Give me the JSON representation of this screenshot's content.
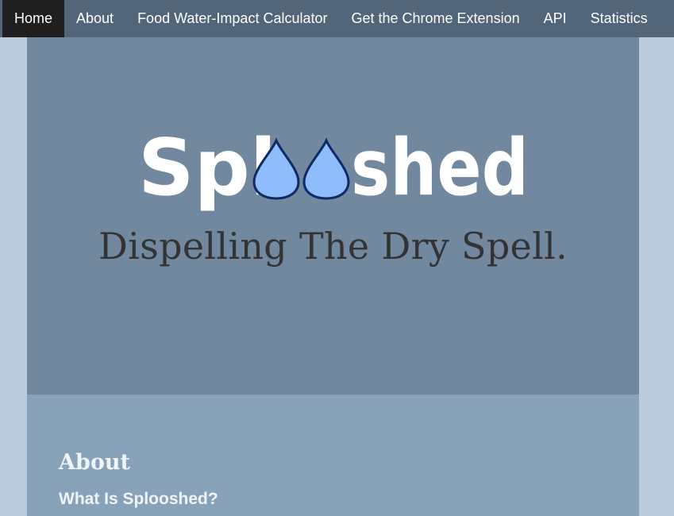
{
  "nav": {
    "items": [
      {
        "label": "Home",
        "active": true
      },
      {
        "label": "About",
        "active": false
      },
      {
        "label": "Food Water-Impact Calculator",
        "active": false
      },
      {
        "label": "Get the Chrome Extension",
        "active": false
      },
      {
        "label": "API",
        "active": false
      },
      {
        "label": "Statistics",
        "active": false
      }
    ]
  },
  "hero": {
    "logo_text": "Splooshed",
    "logo_part_start": "Spl",
    "logo_part_end": "shed",
    "tagline": "Dispelling The Dry Spell."
  },
  "about": {
    "heading": "About",
    "subheading": "What Is Splooshed?"
  },
  "colors": {
    "navbar": "#536579",
    "nav_active": "#1f1f1f",
    "hero_bg": "#71889f",
    "about_bg": "#87a2b9",
    "page_bg": "#bbcbdb",
    "droplet_fill": "#8fbdfb",
    "droplet_stroke": "#0d2a66"
  }
}
